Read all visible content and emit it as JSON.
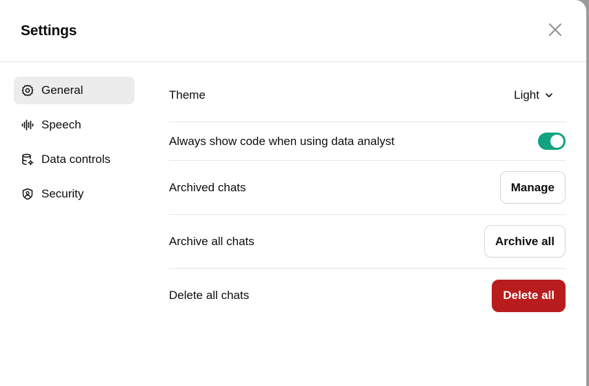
{
  "modal": {
    "title": "Settings"
  },
  "sidebar": {
    "items": [
      {
        "label": "General",
        "icon": "gear-icon",
        "active": true
      },
      {
        "label": "Speech",
        "icon": "waveform-icon",
        "active": false
      },
      {
        "label": "Data controls",
        "icon": "database-settings-icon",
        "active": false
      },
      {
        "label": "Security",
        "icon": "shield-icon",
        "active": false
      }
    ]
  },
  "general": {
    "theme_label": "Theme",
    "theme_value": "Light",
    "code_label": "Always show code when using data analyst",
    "code_enabled": true,
    "archived_label": "Archived chats",
    "archived_button": "Manage",
    "archive_all_label": "Archive all chats",
    "archive_all_button": "Archive all",
    "delete_all_label": "Delete all chats",
    "delete_all_button": "Delete all"
  },
  "colors": {
    "toggle_on": "#10a37f",
    "danger": "#b91c1c",
    "active_bg": "#ececec"
  }
}
